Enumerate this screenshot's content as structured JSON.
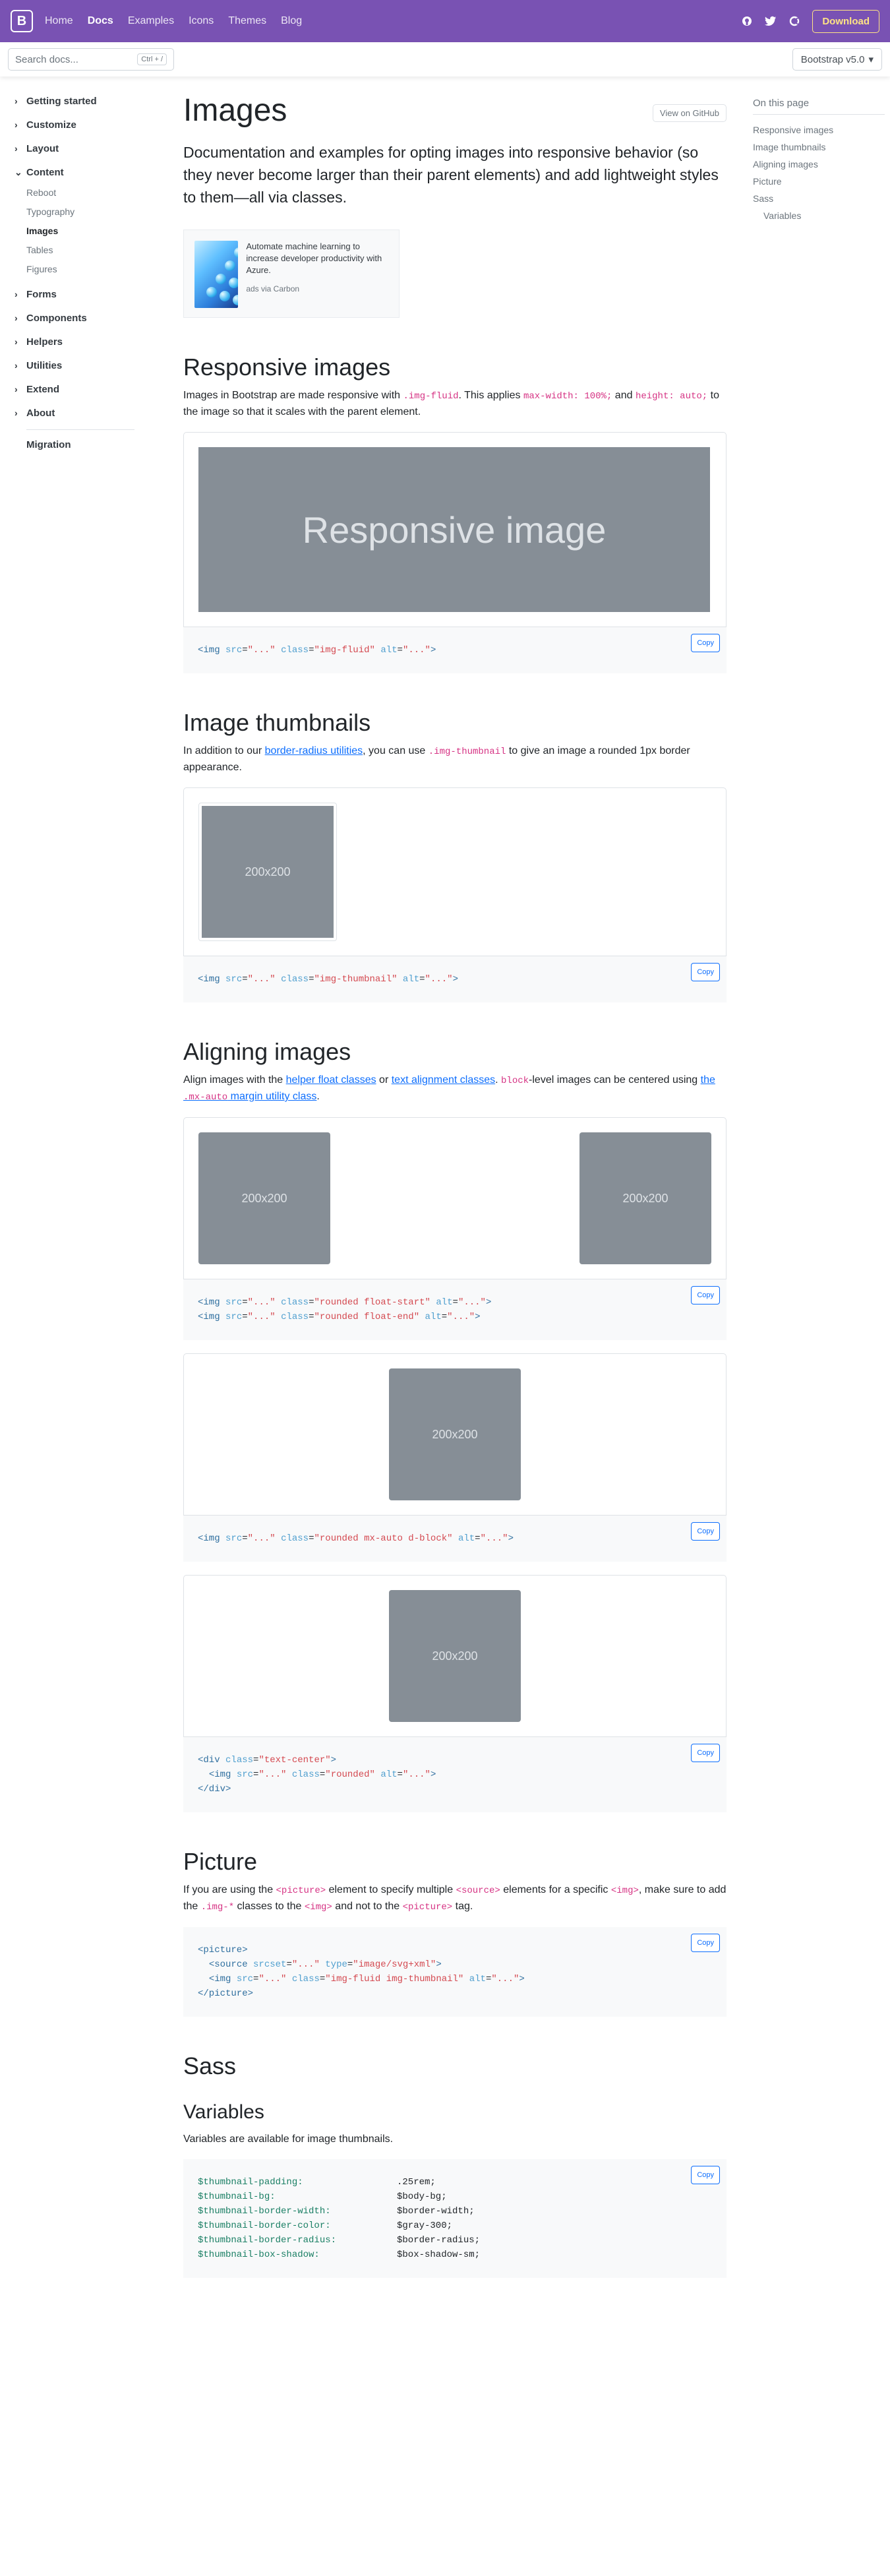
{
  "navbar": {
    "brand": "B",
    "links": [
      "Home",
      "Docs",
      "Examples",
      "Icons",
      "Themes",
      "Blog"
    ],
    "download": "Download"
  },
  "subnav": {
    "search_placeholder": "Search docs...",
    "shortcut": "Ctrl + /",
    "version": "Bootstrap v5.0"
  },
  "sidebar": {
    "groups": [
      "Getting started",
      "Customize",
      "Layout",
      "Content",
      "Forms",
      "Components",
      "Helpers",
      "Utilities",
      "Extend",
      "About"
    ],
    "content_items": [
      "Reboot",
      "Typography",
      "Images",
      "Tables",
      "Figures"
    ],
    "migration": "Migration"
  },
  "toc": {
    "title": "On this page",
    "items": [
      "Responsive images",
      "Image thumbnails",
      "Aligning images",
      "Picture",
      "Sass",
      "Variables"
    ]
  },
  "page": {
    "title": "Images",
    "github_button": "View on GitHub",
    "lead": "Documentation and examples for opting images into responsive behavior (so they never become larger than their parent elements) and add lightweight styles to them—all via classes."
  },
  "ad": {
    "text": "Automate machine learning to increase developer productivity with Azure.",
    "via": "ads via Carbon"
  },
  "responsive": {
    "heading": "Responsive images",
    "p1": "Images in Bootstrap are made responsive with ",
    "c1": ".img-fluid",
    "p2": ". This applies ",
    "c2": "max-width: 100%;",
    "p3": " and ",
    "c3": "height: auto;",
    "p4": " to the image so that it scales with the parent element.",
    "placeholder": "Responsive image"
  },
  "thumbnails": {
    "heading": "Image thumbnails",
    "p1": "In addition to our ",
    "link": "border-radius utilities",
    "p2": ", you can use ",
    "c1": ".img-thumbnail",
    "p3": " to give an image a rounded 1px border appearance.",
    "placeholder": "200x200"
  },
  "aligning": {
    "heading": "Aligning images",
    "p1": "Align images with the ",
    "link1": "helper float classes",
    "p2": " or ",
    "link2": "text alignment classes",
    "p3": ". ",
    "c1": "block",
    "p4": "-level images can be centered using ",
    "link3a": "the ",
    "link3code": ".mx-auto",
    "link3b": " margin utility class",
    "p5": ".",
    "placeholder": "200x200"
  },
  "picture": {
    "heading": "Picture",
    "p1": "If you are using the ",
    "c1": "<picture>",
    "p2": " element to specify multiple ",
    "c2": "<source>",
    "p3": " elements for a specific ",
    "c3": "<img>",
    "p4": ", make sure to add the ",
    "c4": ".img-*",
    "p5": " classes to the ",
    "c5": "<img>",
    "p6": " and not to the ",
    "c6": "<picture>",
    "p7": " tag."
  },
  "sass": {
    "heading": "Sass",
    "variables_heading": "Variables",
    "variables_text": "Variables are available for image thumbnails.",
    "vars": [
      {
        "name": "$thumbnail-padding:",
        "value": ".25rem;"
      },
      {
        "name": "$thumbnail-bg:",
        "value": "$body-bg;"
      },
      {
        "name": "$thumbnail-border-width:",
        "value": "$border-width;"
      },
      {
        "name": "$thumbnail-border-color:",
        "value": "$gray-300;"
      },
      {
        "name": "$thumbnail-border-radius:",
        "value": "$border-radius;"
      },
      {
        "name": "$thumbnail-box-shadow:",
        "value": "$box-shadow-sm;"
      }
    ]
  },
  "copy_label": "Copy",
  "colors": {
    "brand_purple": "#7952b3",
    "download_yellow": "#ffe484",
    "placeholder_gray": "#868e96",
    "link_blue": "#0d6efd",
    "code_pink": "#d63384"
  }
}
